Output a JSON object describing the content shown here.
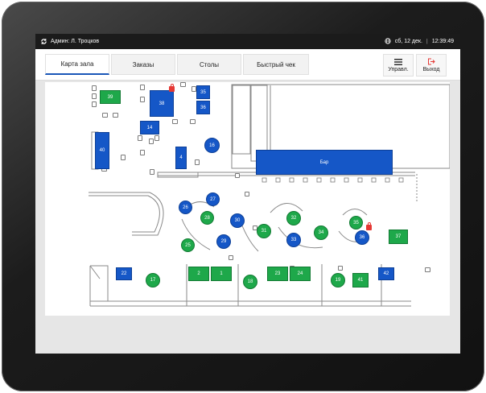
{
  "status": {
    "user": "Админ: Л. Троцков",
    "date": "сб, 12 дек.",
    "time": "12:39:49"
  },
  "tabs": [
    {
      "label": "Карта зала",
      "active": true
    },
    {
      "label": "Заказы",
      "active": false
    },
    {
      "label": "Столы",
      "active": false
    },
    {
      "label": "Быстрый чек",
      "active": false
    }
  ],
  "actions": {
    "manage": "Управл.",
    "exit": "Выход"
  },
  "bar_label": "Бар",
  "colors": {
    "occupied": "#1557c7",
    "free": "#1ea84a",
    "locked": "#e53935"
  },
  "tables": [
    {
      "id": "39",
      "num": "39",
      "status": "free"
    },
    {
      "id": "38",
      "num": "38",
      "status": "occupied",
      "locked": true
    },
    {
      "id": "35",
      "num": "35",
      "status": "occupied"
    },
    {
      "id": "36a",
      "num": "36",
      "status": "occupied"
    },
    {
      "id": "14",
      "num": "14",
      "status": "occupied"
    },
    {
      "id": "40",
      "num": "40",
      "status": "occupied"
    },
    {
      "id": "4",
      "num": "4",
      "status": "occupied"
    },
    {
      "id": "16",
      "num": "16",
      "status": "occupied"
    },
    {
      "id": "26",
      "num": "26",
      "status": "occupied"
    },
    {
      "id": "27",
      "num": "27",
      "status": "occupied"
    },
    {
      "id": "28",
      "num": "28",
      "status": "free"
    },
    {
      "id": "30",
      "num": "30",
      "status": "occupied"
    },
    {
      "id": "25",
      "num": "25",
      "status": "free"
    },
    {
      "id": "29",
      "num": "29",
      "status": "occupied"
    },
    {
      "id": "31",
      "num": "31",
      "status": "free"
    },
    {
      "id": "32",
      "num": "32",
      "status": "free"
    },
    {
      "id": "33",
      "num": "33",
      "status": "occupied"
    },
    {
      "id": "34",
      "num": "34",
      "status": "free"
    },
    {
      "id": "35b",
      "num": "35",
      "status": "free"
    },
    {
      "id": "36b",
      "num": "36",
      "status": "occupied",
      "locked": true
    },
    {
      "id": "37",
      "num": "37",
      "status": "free"
    },
    {
      "id": "22",
      "num": "22",
      "status": "occupied"
    },
    {
      "id": "17",
      "num": "17",
      "status": "free"
    },
    {
      "id": "2",
      "num": "2",
      "status": "free"
    },
    {
      "id": "1",
      "num": "1",
      "status": "free"
    },
    {
      "id": "18",
      "num": "18",
      "status": "free"
    },
    {
      "id": "23",
      "num": "23",
      "status": "free"
    },
    {
      "id": "24",
      "num": "24",
      "status": "free"
    },
    {
      "id": "19",
      "num": "19",
      "status": "free"
    },
    {
      "id": "41",
      "num": "41",
      "status": "free"
    },
    {
      "id": "42",
      "num": "42",
      "status": "occupied"
    }
  ]
}
